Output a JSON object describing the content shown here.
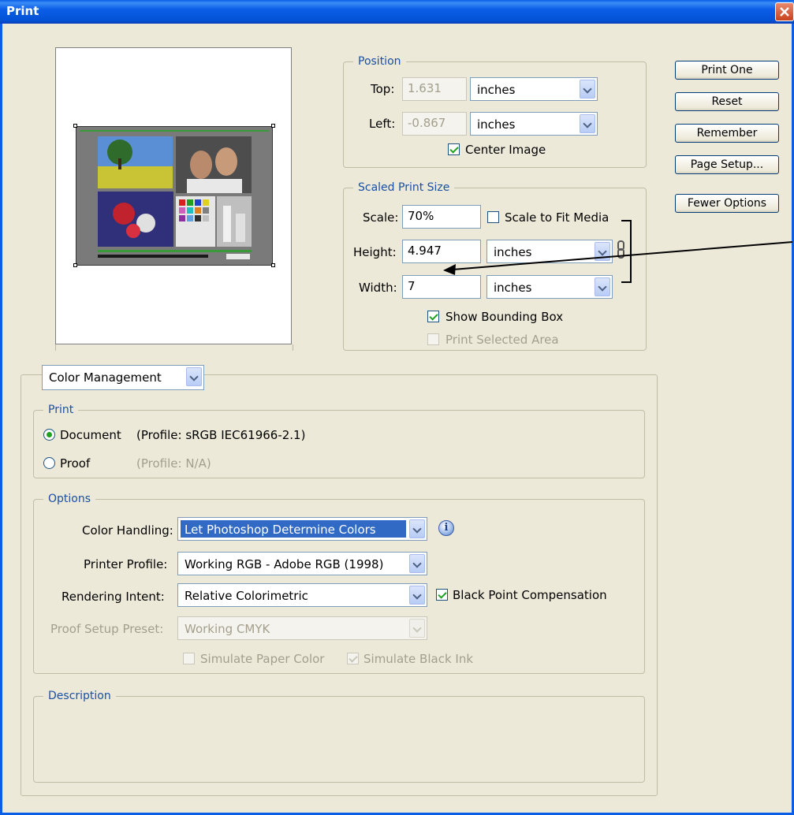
{
  "window": {
    "title": "Print"
  },
  "buttons": {
    "print_one": "Print One",
    "reset": "Reset",
    "remember": "Remember",
    "page_setup": "Page Setup...",
    "fewer_options": "Fewer Options"
  },
  "position": {
    "legend": "Position",
    "top_label": "Top:",
    "top_value": "1.631",
    "top_unit": "inches",
    "left_label": "Left:",
    "left_value": "-0.867",
    "left_unit": "inches",
    "center_image_label": "Center Image",
    "center_image_checked": true
  },
  "scaled": {
    "legend": "Scaled Print Size",
    "scale_label": "Scale:",
    "scale_value": "70%",
    "scale_to_fit_label": "Scale to Fit Media",
    "scale_to_fit_checked": false,
    "height_label": "Height:",
    "height_value": "4.947",
    "height_unit": "inches",
    "width_label": "Width:",
    "width_value": "7",
    "width_unit": "inches",
    "show_bounding_label": "Show Bounding Box",
    "show_bounding_checked": true,
    "print_selected_label": "Print Selected Area",
    "print_selected_checked": false
  },
  "section_select": "Color Management",
  "print_group": {
    "legend": "Print",
    "document_label": "Document",
    "document_profile": "(Profile: sRGB IEC61966-2.1)",
    "proof_label": "Proof",
    "proof_profile": "(Profile: N/A)",
    "selected": "document"
  },
  "options": {
    "legend": "Options",
    "color_handling_label": "Color Handling:",
    "color_handling_value": "Let Photoshop Determine Colors",
    "printer_profile_label": "Printer Profile:",
    "printer_profile_value": "Working RGB - Adobe RGB (1998)",
    "rendering_intent_label": "Rendering Intent:",
    "rendering_intent_value": "Relative Colorimetric",
    "bpc_label": "Black Point Compensation",
    "bpc_checked": true,
    "proof_setup_label": "Proof Setup Preset:",
    "proof_setup_value": "Working CMYK",
    "simulate_paper_label": "Simulate Paper Color",
    "simulate_paper_checked": false,
    "simulate_black_label": "Simulate Black Ink",
    "simulate_black_checked": true
  },
  "description": {
    "legend": "Description"
  },
  "colors": {
    "title_bar": "#0a5ee6",
    "dialog_bg": "#ece9d8",
    "legend_text": "#1a4fa6",
    "selection": "#316ac5",
    "check_mark": "#21a121"
  },
  "icons": {
    "close": "close-icon",
    "info": "info-icon",
    "link": "chain-link-icon",
    "dropdown": "chevron-down-icon"
  }
}
